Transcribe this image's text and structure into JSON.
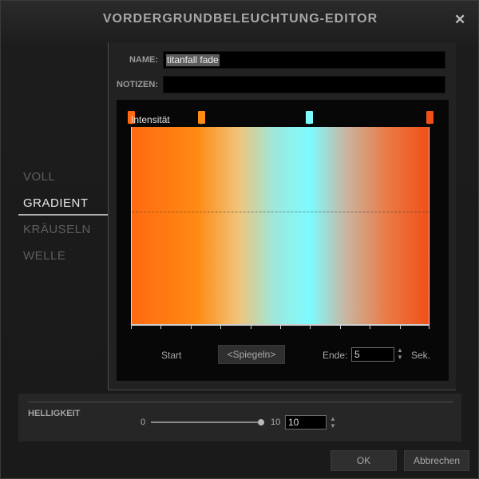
{
  "window": {
    "title": "VORDERGRUNDBELEUCHTUNG-EDITOR",
    "close": "✕"
  },
  "nav": {
    "items": [
      {
        "label": "VOLL",
        "active": false
      },
      {
        "label": "GRADIENT",
        "active": true
      },
      {
        "label": "KRÄUSELN",
        "active": false
      },
      {
        "label": "WELLE",
        "active": false
      }
    ]
  },
  "form": {
    "name_label": "NAME:",
    "name_value": "titanfall fade",
    "notes_label": "NOTIZEN:",
    "notes_value": ""
  },
  "editor": {
    "intensity_label": "Intensität",
    "markers": [
      {
        "position": 0.0,
        "color": "#ff6a10"
      },
      {
        "position": 0.237,
        "color": "#ff8a14"
      },
      {
        "position": 0.597,
        "color": "#7dfbff"
      },
      {
        "position": 1.0,
        "color": "#f05018"
      }
    ],
    "start_label": "Start",
    "mirror_label": "<Spiegeln>",
    "end_label": "Ende:",
    "end_value": "5",
    "unit_label": "Sek.",
    "tick_count": 11
  },
  "brightness": {
    "label": "HELLIGKEIT",
    "min_label": "0",
    "max_label": "10",
    "value": "10",
    "level": 1.0
  },
  "footer": {
    "ok_label": "OK",
    "cancel_label": "Abbrechen"
  }
}
